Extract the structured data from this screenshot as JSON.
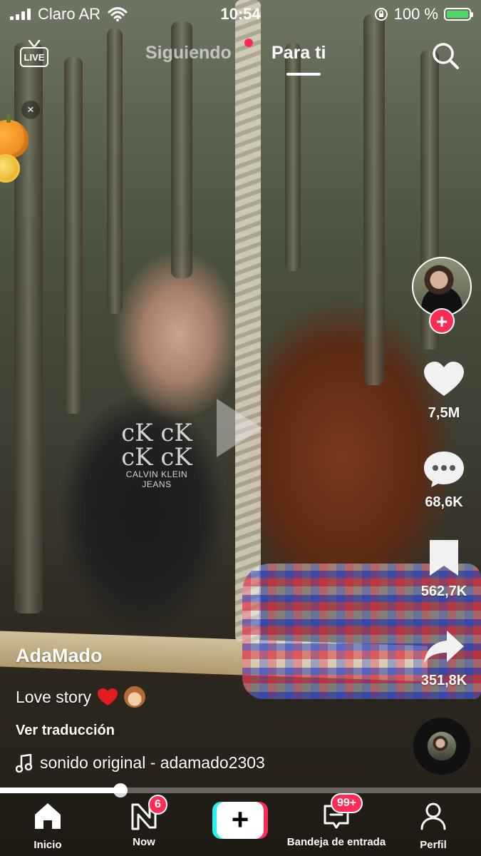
{
  "status_bar": {
    "carrier": "Claro AR",
    "time": "10:54",
    "battery_percent": "100 %",
    "battery_color": "#4cd964"
  },
  "top_nav": {
    "live_label": "LIVE",
    "tabs": [
      {
        "label": "Siguiendo",
        "active": false,
        "has_dot": true
      },
      {
        "label": "Para ti",
        "active": true
      }
    ],
    "search_icon": "search-icon"
  },
  "promo": {
    "close_label": "×",
    "icon": "pumpkin-coin-icon"
  },
  "right_rail": {
    "follow_label": "+",
    "likes": "7,5M",
    "comments": "68,6K",
    "saves": "562,7K",
    "shares": "351,8K"
  },
  "video": {
    "username": "AdaMado",
    "description": "Love story",
    "description_emojis": [
      "red-heart",
      "see-no-evil-monkey"
    ],
    "translate_label": "Ver traducción",
    "sound": "sonido original - adamado2303",
    "shirt_print_line1": "cK cK",
    "shirt_print_line2": "cK cK",
    "shirt_print_text": "CALVIN KLEIN JEANS",
    "progress": 0.25
  },
  "bottom_nav": {
    "items": [
      {
        "label": "Inicio",
        "icon": "home-icon",
        "active": true
      },
      {
        "label": "Now",
        "icon": "now-icon",
        "badge": "6"
      },
      {
        "label": "",
        "icon": "create-plus-icon"
      },
      {
        "label": "Bandeja de entrada",
        "icon": "inbox-icon",
        "badge": "99+"
      },
      {
        "label": "Perfil",
        "icon": "profile-icon"
      }
    ],
    "accent_red": "#fe2c55",
    "accent_cyan": "#25f4ee"
  }
}
